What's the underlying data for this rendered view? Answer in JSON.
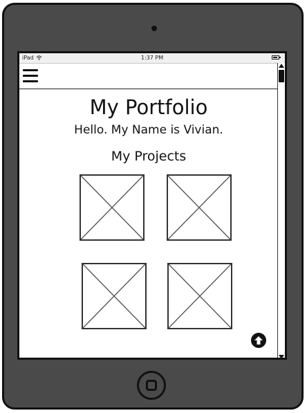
{
  "statusbar": {
    "carrier": "iPad",
    "time": "1:37 PM",
    "icons": [
      "wifi-icon",
      "battery-icon"
    ]
  },
  "header": {
    "menu_icon": "hamburger-menu-icon"
  },
  "main": {
    "title": "My Portfolio",
    "greeting": "Hello. My Name is Vivian.",
    "section_title": "My Projects",
    "projects": [
      {
        "image": "placeholder-image"
      },
      {
        "image": "placeholder-image"
      },
      {
        "image": "placeholder-image"
      },
      {
        "image": "placeholder-image"
      }
    ]
  },
  "controls": {
    "back_to_top_icon": "arrow-up-circle-icon",
    "home_button_icon": "home-button-icon"
  },
  "colors": {
    "frame": "#4a4a4a",
    "outline": "#111111",
    "screen": "#ffffff"
  }
}
